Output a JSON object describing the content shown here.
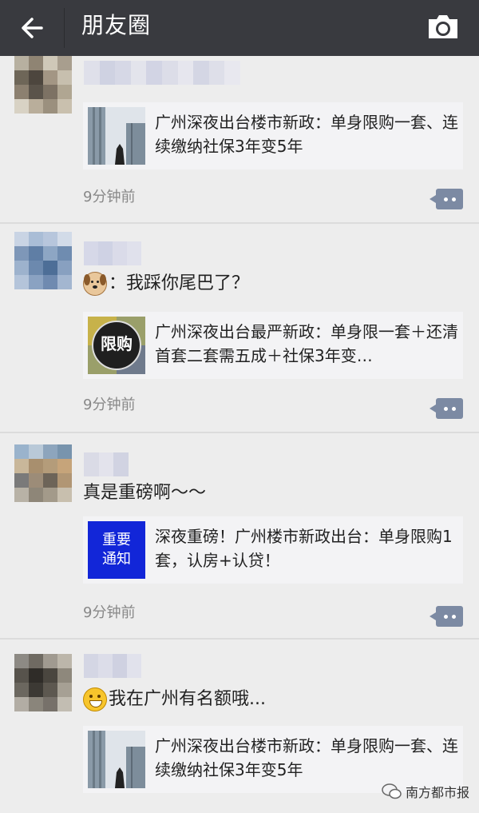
{
  "header": {
    "title": "朋友圈"
  },
  "posts": [
    {
      "text": "",
      "card_text": "广州深夜出台楼市新政：单身限购一套、连续缴纳社保3年变5年",
      "time": "9分钟前"
    },
    {
      "text": "：我踩你尾巴了？",
      "card_text": "广州深夜出台最严新政：单身限一套＋还清首套二套需五成＋社保3年变…",
      "card_thumb_text": "限购",
      "time": "9分钟前"
    },
    {
      "text": "真是重磅啊～～",
      "card_text": "深夜重磅！广州楼市新政出台：单身限购1套，认房+认贷！",
      "card_thumb_text": "重要\n通知",
      "time": "9分钟前"
    },
    {
      "text": "我在广州有名额哦...",
      "card_text": "广州深夜出台楼市新政：单身限购一套、连续缴纳社保3年变5年",
      "time": ""
    }
  ],
  "watermark": {
    "text": "南方都市报"
  }
}
